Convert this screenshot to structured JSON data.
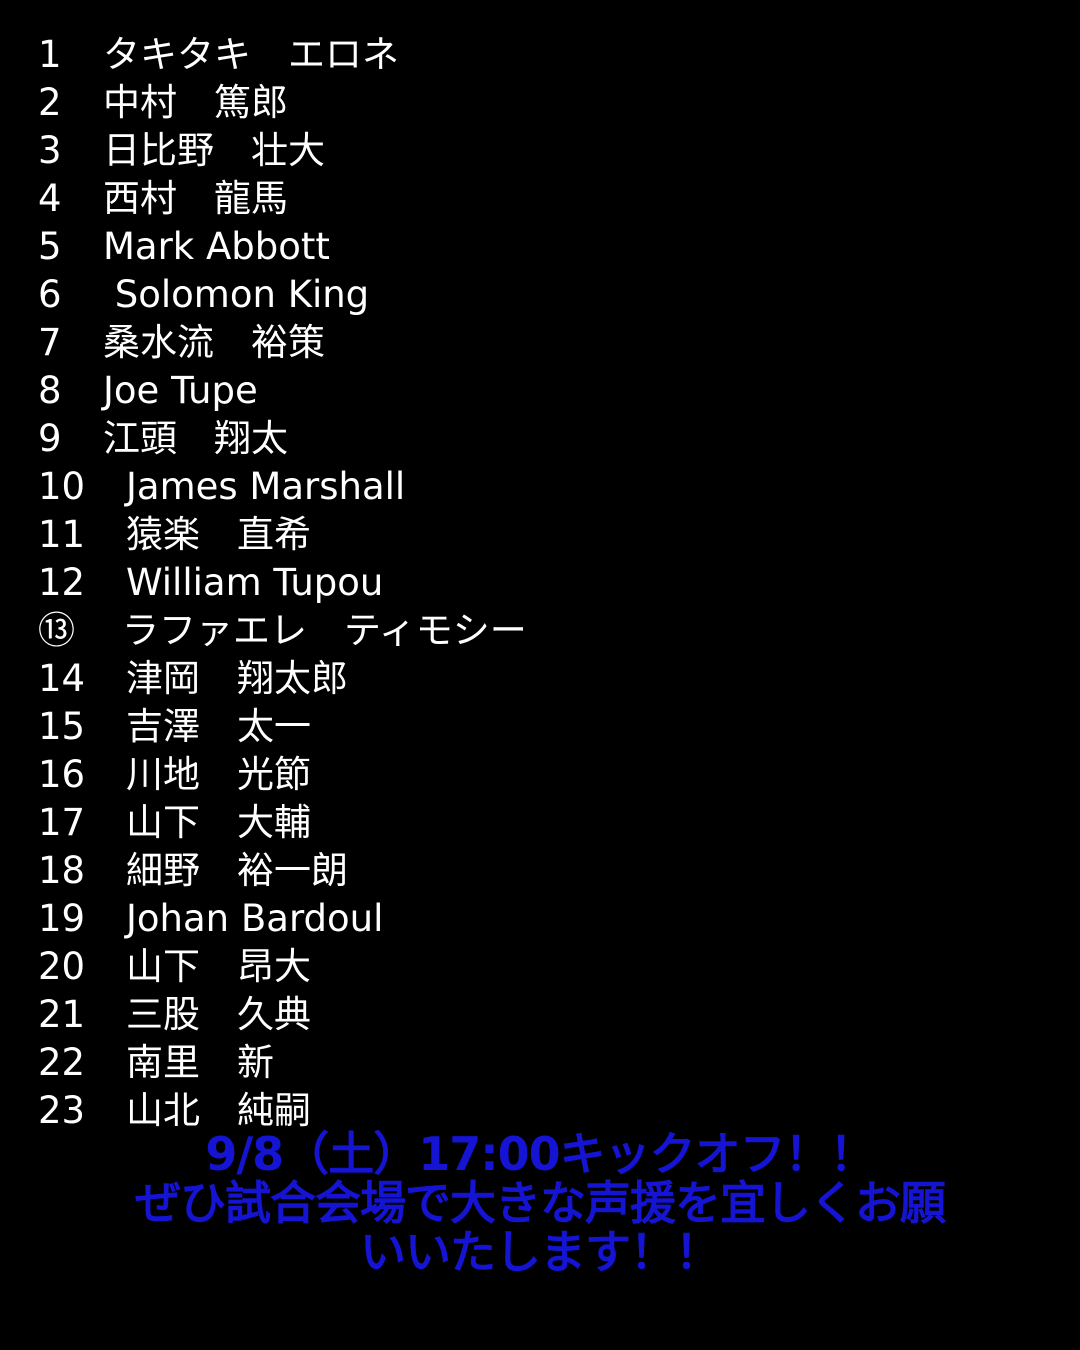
{
  "roster": [
    {
      "number": "1",
      "name": "タキタキ　エロネ"
    },
    {
      "number": "2",
      "name": "中村　篤郎"
    },
    {
      "number": "3",
      "name": "日比野　壮大"
    },
    {
      "number": "4",
      "name": "西村　龍馬"
    },
    {
      "number": "5",
      "name": "Mark Abbott"
    },
    {
      "number": "6",
      "name": " Solomon King"
    },
    {
      "number": "7",
      "name": "桑水流　裕策"
    },
    {
      "number": "8",
      "name": "Joe Tupe"
    },
    {
      "number": "9",
      "name": "江頭　翔太"
    },
    {
      "number": "10",
      "name": "James Marshall"
    },
    {
      "number": "11",
      "name": "猿楽　直希"
    },
    {
      "number": "12",
      "name": "William Tupou"
    },
    {
      "number": "⑬",
      "name": "ラファエレ　ティモシー"
    },
    {
      "number": "14",
      "name": "津岡　翔太郎"
    },
    {
      "number": "15",
      "name": "吉澤　太一"
    },
    {
      "number": "16",
      "name": "川地　光節"
    },
    {
      "number": "17",
      "name": "山下　大輔"
    },
    {
      "number": "18",
      "name": "細野　裕一朗"
    },
    {
      "number": "19",
      "name": "Johan Bardoul"
    },
    {
      "number": "20",
      "name": "山下　昂大"
    },
    {
      "number": "21",
      "name": "三股　久典"
    },
    {
      "number": "22",
      "name": "南里　新"
    },
    {
      "number": "23",
      "name": "山北　純嗣"
    }
  ],
  "message": {
    "line1": "9/8（土）17:00キックオフ！！",
    "line2": "ぜひ試合会場で大きな声援を宜しくお願",
    "line3": "いいたします！！"
  },
  "colors": {
    "background": "#000000",
    "roster_text": "#ffffff",
    "message_text": "#1414d2"
  }
}
